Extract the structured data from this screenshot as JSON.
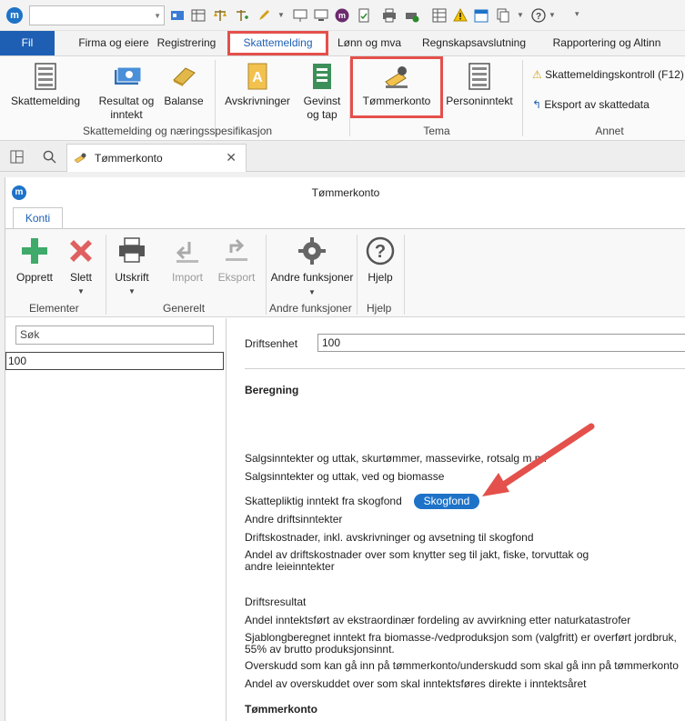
{
  "app": {
    "logo_letter": "m",
    "ribbon_tabs": [
      {
        "label": "Fil"
      },
      {
        "label": "Firma og eiere"
      },
      {
        "label": "Registrering"
      },
      {
        "label": "Skattemelding"
      },
      {
        "label": "Lønn og mva"
      },
      {
        "label": "Regnskapsavslutning"
      },
      {
        "label": "Rapportering og Altinn"
      }
    ],
    "ribbon_buttons": {
      "skattemelding": "Skattemelding",
      "resultat": "Resultat og inntekt",
      "balanse": "Balanse",
      "avskrivninger": "Avskrivninger",
      "gevinst": "Gevinst og tap",
      "tommerkonto": "Tømmerkonto",
      "personinntekt": "Personinntekt",
      "skattemeldingskontroll": "Skattemeldingskontroll (F12)",
      "eksport": "Eksport av skattedata"
    },
    "ribbon_groups": {
      "skatt_naering": "Skattemelding og næringsspesifikasjon",
      "tema": "Tema",
      "annet": "Annet"
    },
    "document_tab": "Tømmerkonto",
    "colors": {
      "accent": "#1e5fb4",
      "highlight": "#e4504b",
      "skogfond": "#1e73c8"
    }
  },
  "window": {
    "title": "Tømmerkonto",
    "tab": "Konti",
    "buttons": {
      "opprett": "Opprett",
      "slett": "Slett",
      "utskrift": "Utskrift",
      "import": "Import",
      "eksport": "Eksport",
      "andre": "Andre funksjoner",
      "hjelp": "Hjelp"
    },
    "groups": {
      "elementer": "Elementer",
      "generelt": "Generelt",
      "andre": "Andre funksjoner",
      "hjelp": "Hjelp"
    }
  },
  "left": {
    "search_placeholder": "Søk",
    "items": [
      "100"
    ]
  },
  "form": {
    "driftsenhet_label": "Driftsenhet",
    "driftsenhet_value": "100",
    "beregning": "Beregning",
    "rows": {
      "r1": "Salgsinntekter og uttak, skurtømmer, massevirke, rotsalg m.m.",
      "r2": "Salgsinntekter og uttak, ved og biomasse",
      "r3": "Skattepliktig inntekt fra skogfond",
      "r4": "Andre driftsinntekter",
      "r5": "Driftskostnader, inkl. avskrivninger og avsetning til skogfond",
      "r6a": "Andel av driftskostnader over som knytter seg til jakt, fiske, torvuttak og",
      "r6b": "andre leieinntekter",
      "r7": "Driftsresultat",
      "r8": "Andel inntektsført av ekstraordinær fordeling av avvirkning etter naturkatastrofer",
      "r9a": "Sjablongberegnet inntekt fra biomasse-/vedproduksjon som (valgfritt) er overført jordbruk,",
      "r9b": "55% av brutto produksjonsinnt.",
      "r10": "Overskudd som kan gå inn på tømmerkonto/underskudd som skal gå inn på tømmerkonto",
      "r11": "Andel av overskuddet over som skal inntektsføres direkte i inntektsåret"
    },
    "skogfond_button": "Skogfond",
    "tommerkonto_section": "Tømmerkonto"
  }
}
